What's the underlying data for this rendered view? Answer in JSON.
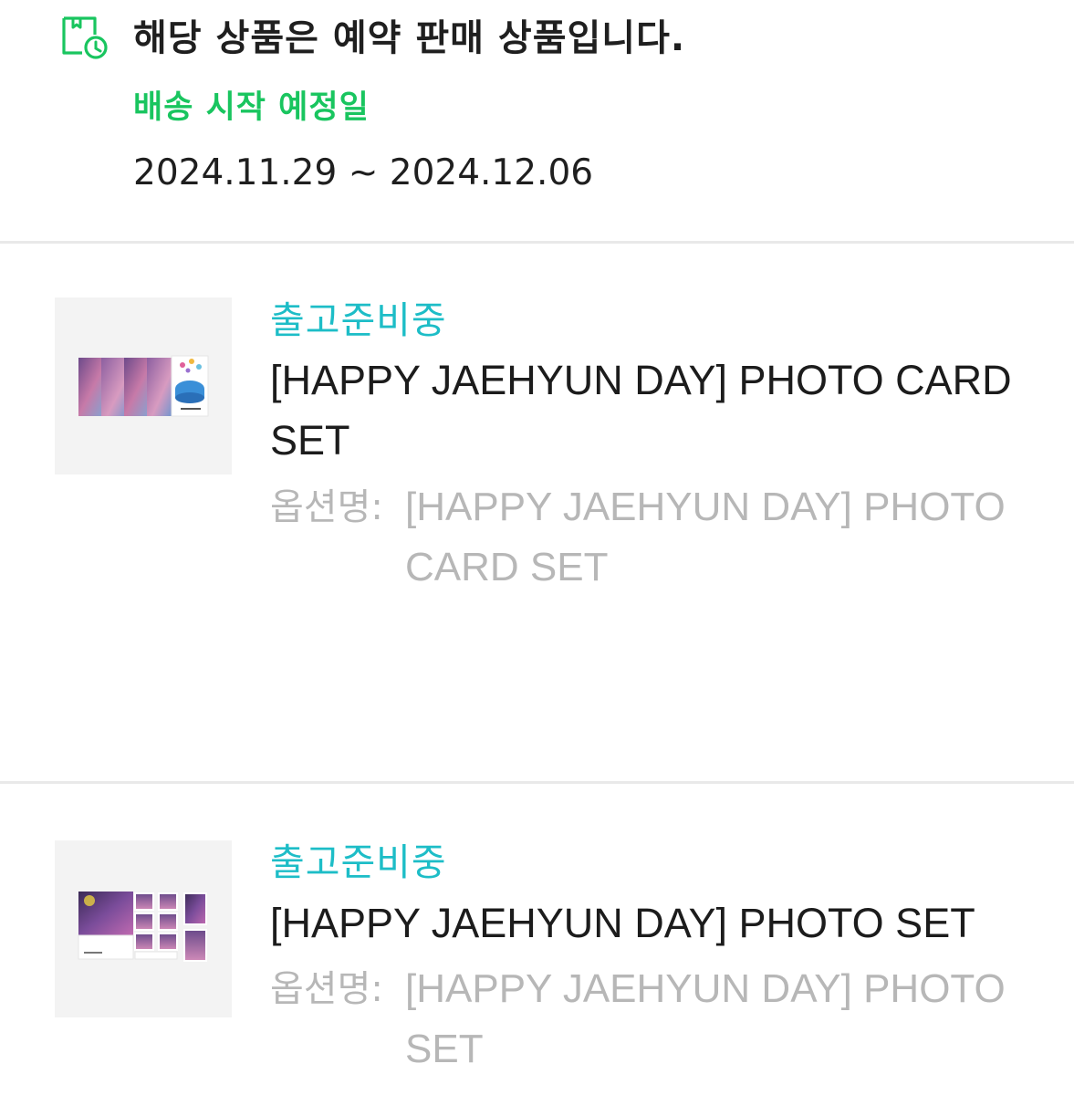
{
  "notice": {
    "title": "해당 상품은 예약 판매 상품입니다.",
    "ship_label": "배송 시작 예정일",
    "ship_dates": "2024.11.29 ~ 2024.12.06",
    "icon": "calendar-clock-icon",
    "accent_color": "#19c55f"
  },
  "status_color": "#1dbdc7",
  "items": [
    {
      "status": "출고준비중",
      "name": "[HAPPY JAEHYUN DAY] PHOTO CARD SET",
      "option_label": "옵션명:",
      "option_value": "[HAPPY JAEHYUN DAY] PHOTO CARD SET",
      "thumbnail": "photo-card-set-thumbnail"
    },
    {
      "status": "출고준비중",
      "name": "[HAPPY JAEHYUN DAY] PHOTO SET",
      "option_label": "옵션명:",
      "option_value": "[HAPPY JAEHYUN DAY] PHOTO SET",
      "thumbnail": "photo-set-thumbnail"
    }
  ]
}
